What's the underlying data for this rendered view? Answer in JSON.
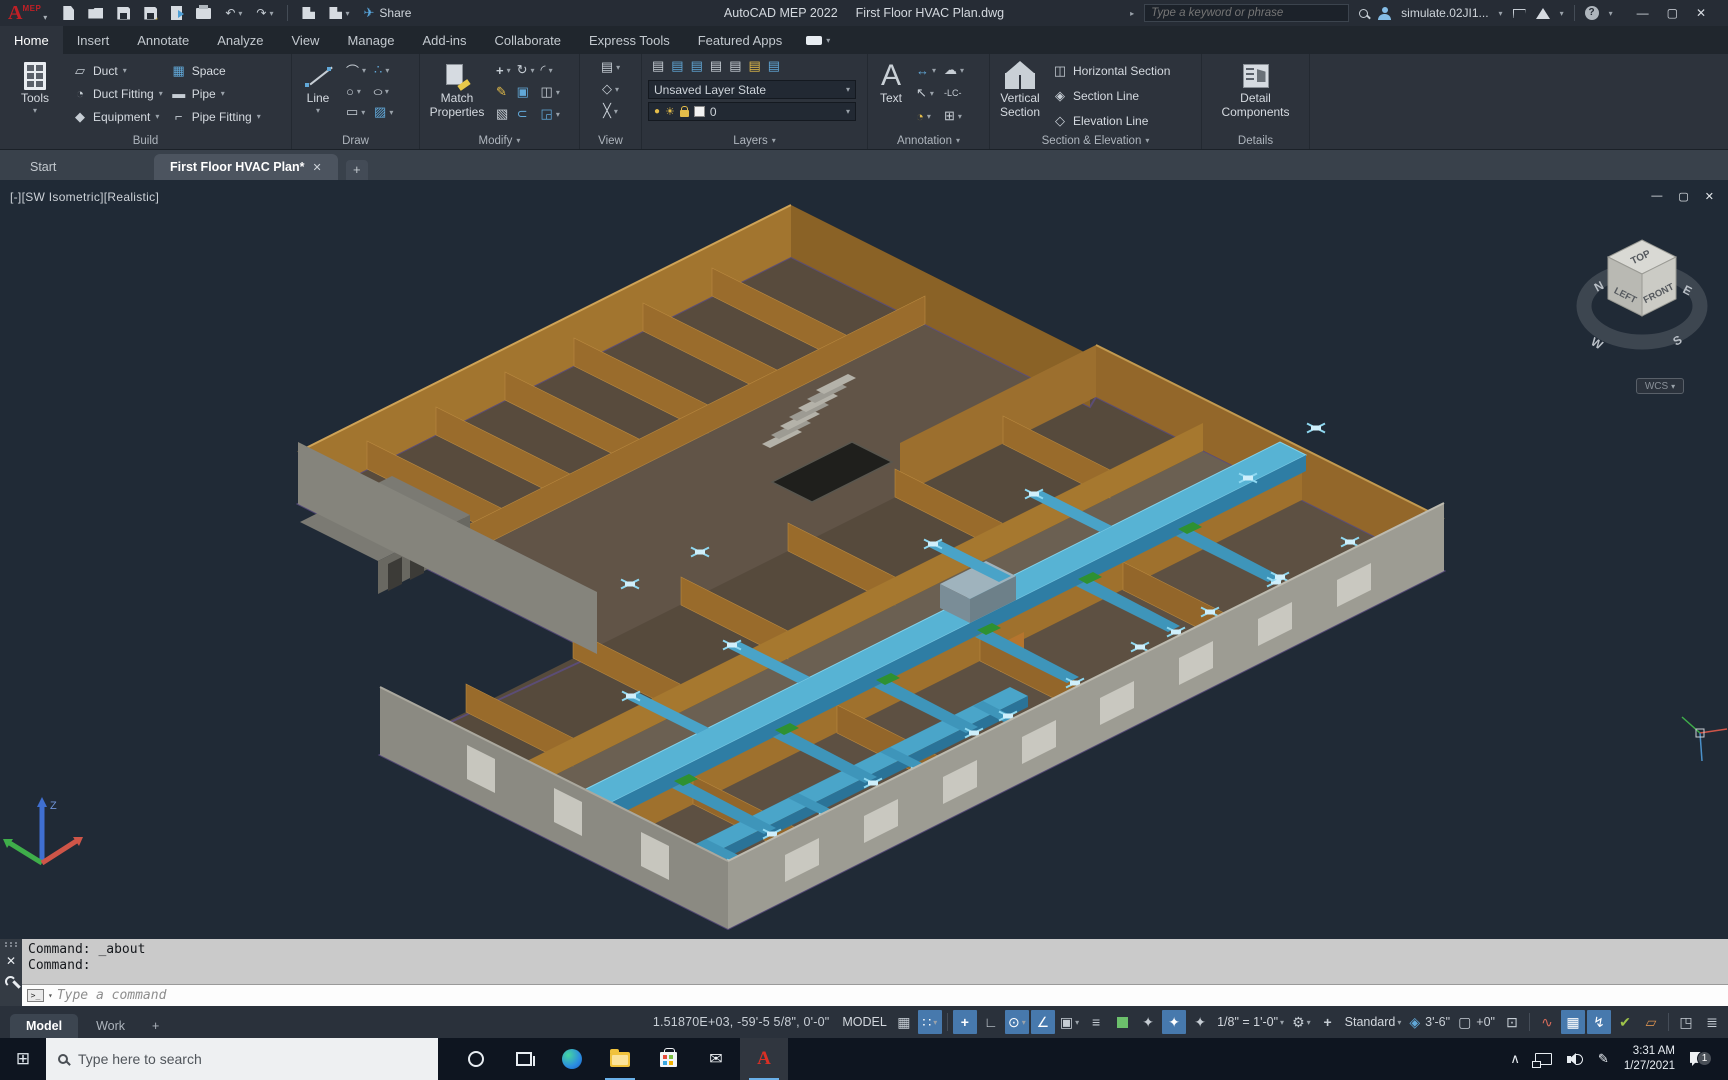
{
  "glyphs": {
    "caret": "▾",
    "caret_r": "▸",
    "undo": "↶",
    "redo": "↷",
    "plane": "✈",
    "win_min": "—",
    "win_box": "▢",
    "win_close": "✕",
    "duct": "▱",
    "duct_fit": "◔",
    "equip": "◆",
    "space": "▦",
    "pipe": "▬",
    "pipe_fit": "⌐",
    "arc": "⌒",
    "points": "∴",
    "circle": "○",
    "ellipse": "○",
    "rect": "▭",
    "hatch": "▨",
    "move": "+",
    "rotate": "↻",
    "fillet": "◜",
    "erase": "✎",
    "copy": "▣",
    "mirror": "◫",
    "box3d": "▧",
    "offset": "⊂",
    "arrange": "◲",
    "v_views": "▤",
    "v_named": "◇",
    "v_vp": "╳",
    "layer": "▤",
    "sun": "☀",
    "bulb": "●",
    "dim": "↔",
    "cloud": "☁",
    "leader": "↖",
    "flag": "◔",
    "table": "⊞",
    "hsec": "◫",
    "sline": "◈",
    "eline": "◇",
    "grid": "▦",
    "snap": "∷",
    "dyn": "+",
    "ortho": "∟",
    "polar": "⊙",
    "otrack": "∠",
    "osnap": "▣",
    "lweight": "≡",
    "annot": "✦",
    "gear": "⚙",
    "plus": "+",
    "cutplane": "◈",
    "elevbox": "▢",
    "isolate": "⊡",
    "perf": "∿",
    "hw": "▦",
    "bolt": "↯",
    "check": "✔",
    "xref": "▱",
    "clean": "◳",
    "burger": "≣",
    "prompt": ">_",
    "start": "⊞",
    "mail": "✉",
    "pen": "✎",
    "chev": "∧"
  },
  "titlebar": {
    "logo_main": "A",
    "logo_sub": "MEP",
    "share": "Share",
    "app_name": "AutoCAD MEP 2022",
    "doc_name": "First Floor HVAC Plan.dwg",
    "search_placeholder": "Type a keyword or phrase",
    "user": "simulate.02JI1..."
  },
  "ribbon_tabs": [
    "Home",
    "Insert",
    "Annotate",
    "Analyze",
    "View",
    "Manage",
    "Add-ins",
    "Collaborate",
    "Express Tools",
    "Featured Apps"
  ],
  "panels": {
    "build": {
      "label": "Build",
      "tools": "Tools",
      "duct": "Duct",
      "duct_fitting": "Duct Fitting",
      "equipment": "Equipment",
      "space": "Space",
      "pipe": "Pipe",
      "pipe_fitting": "Pipe Fitting"
    },
    "draw": {
      "label": "Draw",
      "line": "Line"
    },
    "modify": {
      "label": "Modify",
      "match1": "Match",
      "match2": "Properties"
    },
    "view": {
      "label": "View"
    },
    "layers": {
      "label": "Layers",
      "state": "Unsaved Layer State",
      "current": "0"
    },
    "annotation": {
      "label": "Annotation",
      "text": "Text",
      "lc": "-LC-"
    },
    "section": {
      "label": "Section & Elevation",
      "vert1": "Vertical",
      "vert2": "Section",
      "horizontal": "Horizontal Section",
      "section_line": "Section Line",
      "elevation_line": "Elevation Line"
    },
    "details": {
      "label": "Details",
      "line1": "Detail",
      "line2": "Components"
    }
  },
  "file_tabs": {
    "start": "Start",
    "active": "First Floor HVAC Plan*"
  },
  "viewport": {
    "label": "[-][SW Isometric][Realistic]",
    "cube": {
      "top": "TOP",
      "left": "LEFT",
      "front": "FRONT",
      "n": "N",
      "e": "E",
      "s": "S",
      "w": "W"
    },
    "wcs": "WCS",
    "ucs_z": "Z"
  },
  "command": {
    "history1": "Command: _about",
    "history2": "Command:",
    "placeholder": "Type a command"
  },
  "statusbar": {
    "model": "Model",
    "work": "Work",
    "add": "+",
    "coords": "1.51870E+03, -59'-5 5/8\", 0'-0\"",
    "space": "MODEL",
    "scale": "1/8\" = 1'-0\"",
    "standard": "Standard",
    "cutplane": "3'-6\"",
    "elev": "+0\""
  },
  "taskbar": {
    "search": "Type here to search",
    "time": "3:31 AM",
    "date": "1/27/2021",
    "badge": "1"
  }
}
